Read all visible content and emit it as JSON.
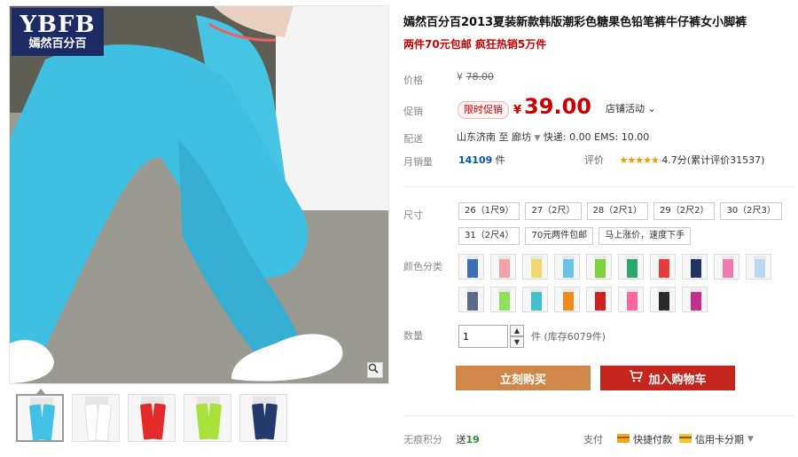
{
  "brand": {
    "logo_line1": "YBFB",
    "logo_line2": "嫣然百分百"
  },
  "product": {
    "title": "嫣然百分百2013夏装新款韩版潮彩色糖果色铅笔裤牛仔裤女小脚裤",
    "subtitle": "两件70元包邮 疯狂热销5万件"
  },
  "pricing": {
    "list_label": "价格",
    "list_currency": "¥",
    "list_price": "78.00",
    "promo_label": "促销",
    "promo_badge": "限时促销",
    "currency": "¥",
    "price": "39.00",
    "store_activity": "店铺活动"
  },
  "delivery": {
    "label": "配送",
    "from": "山东济南",
    "to_word": "至",
    "to": "廊坊",
    "fee": "快递: 0.00 EMS: 10.00"
  },
  "sales": {
    "label": "月销量",
    "count": "14109",
    "unit": "件",
    "rating_label": "评价",
    "stars": "★★★★★",
    "rating_text": "4.7分(累计评价31537)",
    "rating_value": 4.7
  },
  "options": {
    "size_label": "尺寸",
    "sizes": [
      "26（1尺9）",
      "27（2尺）",
      "28（2尺1）",
      "29（2尺2）",
      "30（2尺3）",
      "31（2尺4）",
      "70元两件包邮",
      "马上涨价，速度下手"
    ],
    "color_label": "颜色分类",
    "colors": [
      "#3a6fb5",
      "#f2a3a8",
      "#f2d86d",
      "#6bc4e8",
      "#7dd13c",
      "#2aa86a",
      "#e83d3d",
      "#223366",
      "#f07ab0",
      "#b9d9f0",
      "#5a6a8a",
      "#8fe05a",
      "#40c0d0",
      "#f28a1a",
      "#d12020",
      "#ff66a0",
      "#2a2a2a",
      "#c42d8a"
    ]
  },
  "quantity": {
    "label": "数量",
    "value": "1",
    "suffix": "件 (库存6079件)"
  },
  "actions": {
    "buy_now": "立刻购买",
    "add_cart": "加入购物车"
  },
  "footer": {
    "points_label": "无痕积分",
    "points_prefix": "送",
    "points_value": "19",
    "pay_label": "支付",
    "pay_method_1": "快捷付款",
    "pay_method_2": "信用卡分期"
  },
  "thumbnails": [
    {
      "color": "#41c1e3"
    },
    {
      "color": "#ffffff"
    },
    {
      "color": "#e32b2b"
    },
    {
      "color": "#a6e23a"
    },
    {
      "color": "#233a6e"
    }
  ]
}
